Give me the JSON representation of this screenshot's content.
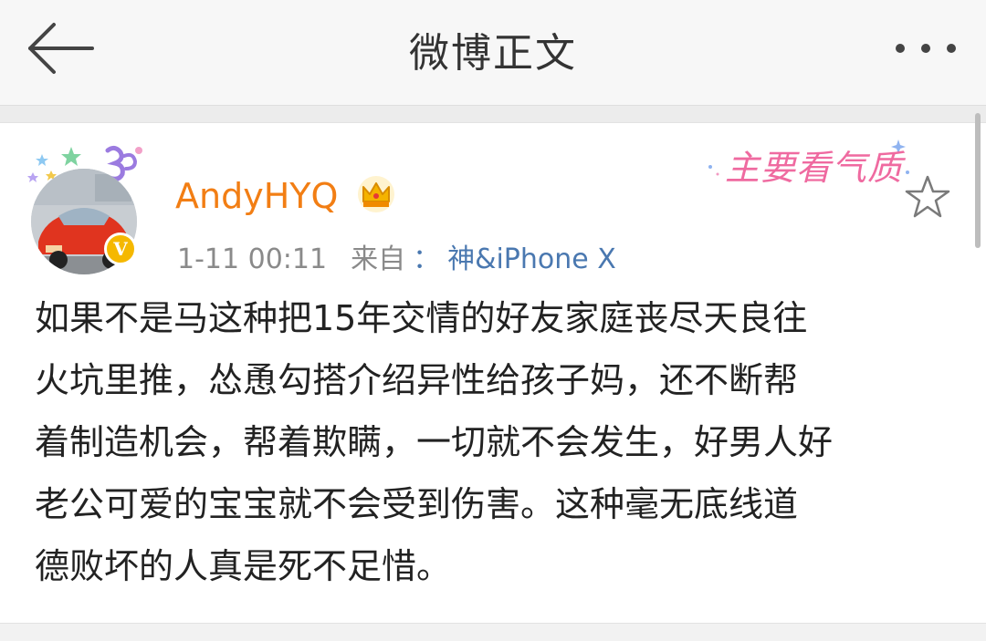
{
  "header": {
    "title": "微博正文",
    "back_icon": "back-arrow-icon",
    "more_icon": "more-horizontal-icon"
  },
  "post": {
    "username": "AndyHYQ",
    "username_color": "#f27e14",
    "time": "1-11 00:11",
    "source_prefix": "来自",
    "source_colon": "：",
    "source": "神&iPhone X",
    "verified_badge": "V",
    "sticker_text": "主要看气质",
    "text": "如果不是马这种把15年交情的好友家庭丧尽天良往\n火坑里推，怂恿勾搭介绍异性给孩子妈，还不断帮\n着制造机会，帮着欺瞒，一切就不会发生，好男人好\n老公可爱的宝宝就不会受到伤害。这种毫无底线道\n德败坏的人真是死不足惜。"
  },
  "colors": {
    "link": "#4a78b0",
    "meta": "#8a8a8a",
    "badge": "#f5b800",
    "sticker": "#ef6aa0"
  }
}
